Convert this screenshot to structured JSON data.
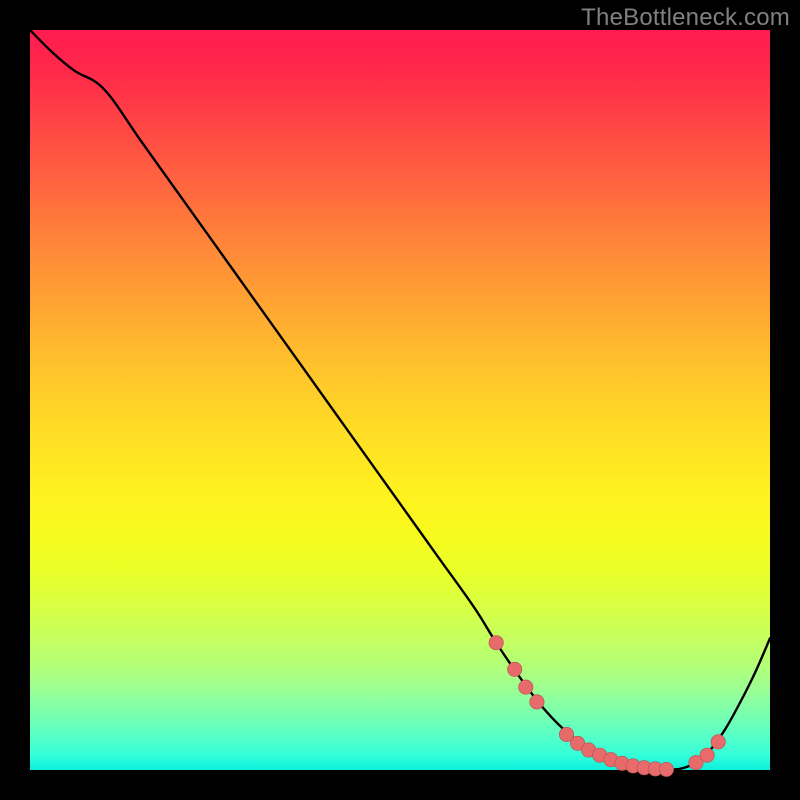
{
  "watermark": "TheBottleneck.com",
  "colors": {
    "page_bg": "#000000",
    "watermark": "#808080",
    "curve": "#000000",
    "marker_fill": "#e86b6b",
    "marker_stroke": "#b44d4d"
  },
  "chart_data": {
    "type": "line",
    "title": "",
    "xlabel": "",
    "ylabel": "",
    "xlim": [
      0,
      100
    ],
    "ylim": [
      0,
      100
    ],
    "grid": false,
    "legend": false,
    "series": [
      {
        "name": "bottleneck-curve",
        "x": [
          0,
          3,
          6,
          10,
          15,
          20,
          25,
          30,
          35,
          40,
          45,
          50,
          55,
          60,
          63,
          66,
          69,
          72,
          75,
          78,
          81,
          84,
          86,
          88,
          90,
          92,
          94,
          96,
          98,
          100
        ],
        "y": [
          100,
          97,
          94.5,
          92,
          85,
          78,
          71,
          64,
          57,
          50,
          43,
          36,
          29,
          22,
          17.2,
          12.8,
          8.8,
          5.6,
          3.2,
          1.6,
          0.6,
          0.15,
          0.05,
          0.2,
          1.0,
          2.8,
          5.6,
          9.2,
          13.2,
          17.8
        ]
      }
    ],
    "markers": {
      "name": "highlight-dots",
      "x": [
        63.0,
        65.5,
        67.0,
        68.5,
        72.5,
        74.0,
        75.5,
        77.0,
        78.5,
        80.0,
        81.5,
        83.0,
        84.5,
        86.0,
        90.0,
        91.5,
        93.0
      ],
      "y": [
        17.2,
        13.6,
        11.2,
        9.2,
        4.8,
        3.6,
        2.7,
        2.0,
        1.4,
        0.9,
        0.55,
        0.3,
        0.15,
        0.08,
        1.0,
        2.0,
        3.8
      ]
    }
  }
}
